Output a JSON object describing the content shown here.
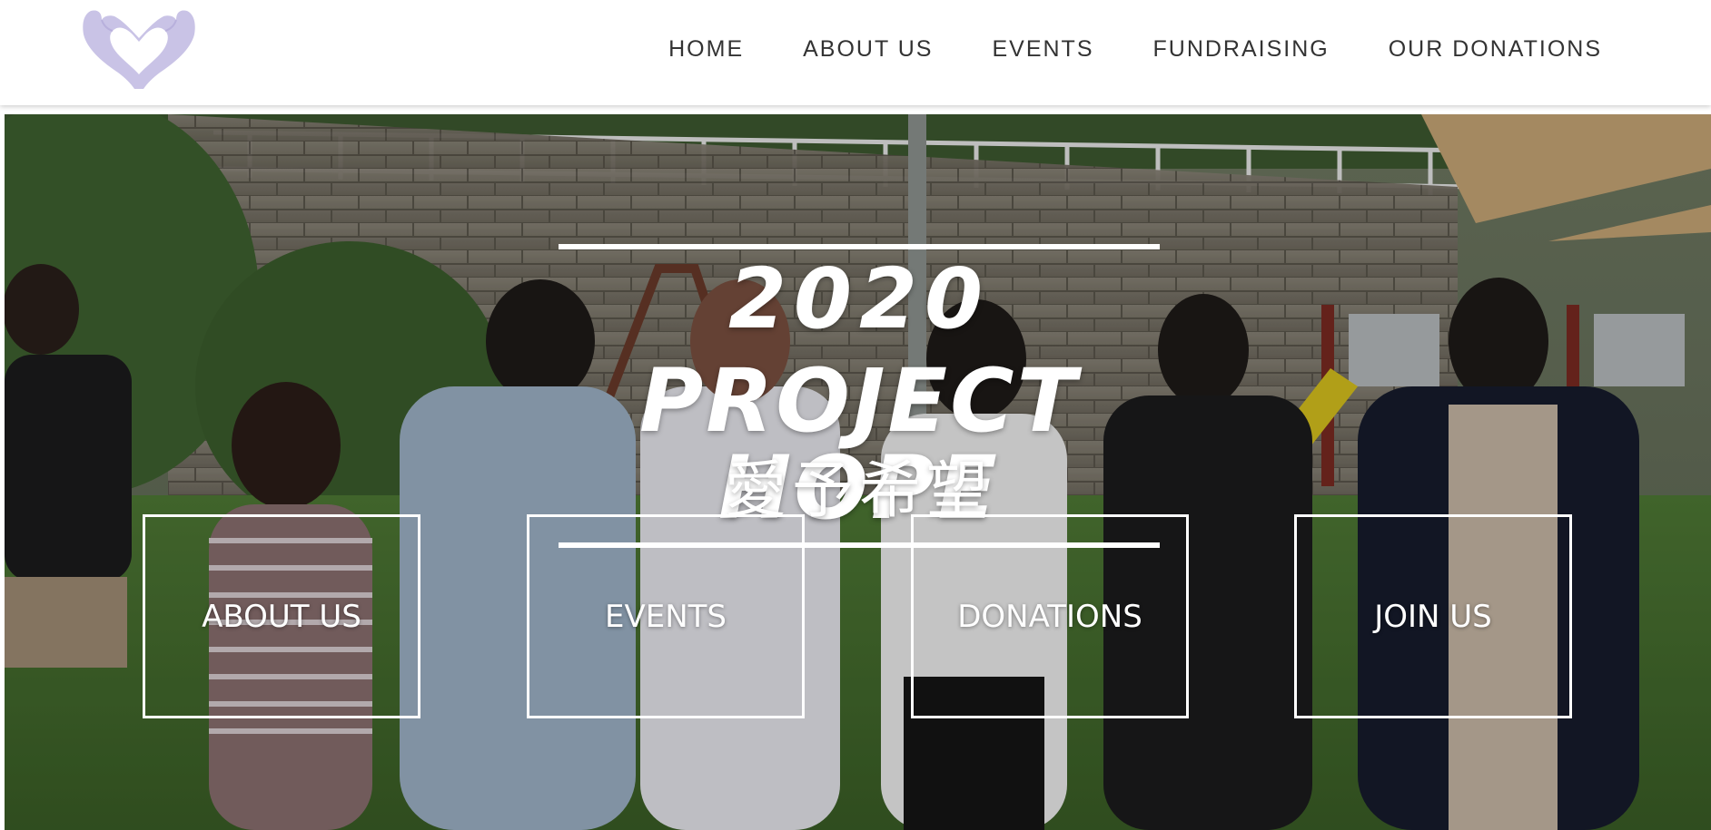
{
  "header": {
    "logo_name": "heart-hands-logo",
    "logo_color": "#c9c3e6",
    "nav": [
      {
        "label": "HOME"
      },
      {
        "label": "ABOUT US"
      },
      {
        "label": "EVENTS"
      },
      {
        "label": "FUNDRAISING"
      },
      {
        "label": "OUR DONATIONS"
      }
    ]
  },
  "hero": {
    "year": "2020",
    "title": "PROJECT HOPE",
    "subtitle_chinese": "愛予希望",
    "buttons": [
      {
        "label": "ABOUT US"
      },
      {
        "label": "EVENTS"
      },
      {
        "label": "DONATIONS"
      },
      {
        "label": "JOIN US"
      }
    ]
  },
  "colors": {
    "nav_text": "#333333",
    "hero_text": "#ffffff",
    "logo": "#c9c3e6"
  }
}
